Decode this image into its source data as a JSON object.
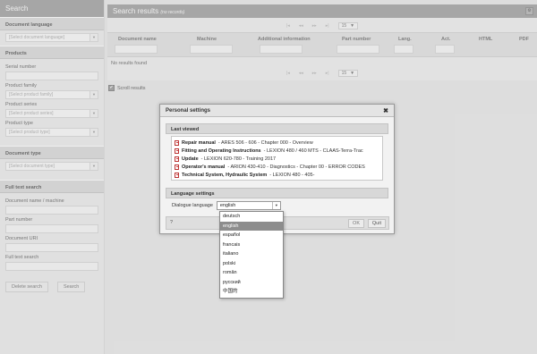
{
  "sidebar": {
    "title": "Search",
    "sections": {
      "document_language": {
        "title": "Document language",
        "select_placeholder": "[Select document language]"
      },
      "products": {
        "title": "Products",
        "serial_number_label": "Serial number",
        "product_family_label": "Product family",
        "product_family_placeholder": "[Select product family]",
        "product_series_label": "Product series",
        "product_series_placeholder": "[Select product series]",
        "product_type_label": "Product type",
        "product_type_placeholder": "[Select product type]"
      },
      "document_type": {
        "title": "Document type",
        "select_placeholder": "[Select document type]"
      },
      "full_text_search": {
        "title": "Full text search",
        "doc_name_label": "Document name / machine",
        "part_number_label": "Part number",
        "document_uri_label": "Document URI",
        "full_text_label": "Full text search"
      }
    },
    "buttons": {
      "delete_search": "Delete search",
      "search": "Search"
    }
  },
  "main": {
    "header_title": "Search results",
    "header_sub": "(no records)",
    "pager": {
      "first": "|◂",
      "prev": "◂◂",
      "next": "▸▸",
      "last": "▸|",
      "page_size": "15"
    },
    "columns": [
      "Document name",
      "Machine",
      "Additional information",
      "Part number",
      "Lang.",
      "Act.",
      "HTML",
      "PDF"
    ],
    "no_results": "No results found",
    "scroll_results": "Scroll results"
  },
  "dialog": {
    "title": "Personal settings",
    "close_glyph": "✖",
    "last_viewed_title": "Last viewed",
    "last_viewed": [
      {
        "bold": "Repair manual",
        "rest": " - ARES 506 - 606 - Chapter 000 - Overview"
      },
      {
        "bold": "Fitting and Operating Instructions",
        "rest": " - LEXION 480 / 460 MTS - CLAAS-Terra-Trac"
      },
      {
        "bold": "Update",
        "rest": " - LEXION 620-780 - Training 2017"
      },
      {
        "bold": "Operator's manual",
        "rest": " - ARION 430-410 - Diagnostics - Chapter 00 - ERROR CODES"
      },
      {
        "bold": "Technical System, Hydraulic System",
        "rest": " - LEXION 480 - 405-"
      }
    ],
    "language_settings_title": "Language settings",
    "dialogue_language_label": "Dialogue language",
    "selected_language": "english",
    "help_label": "?",
    "ok_label": "OK",
    "quit_label": "Quit"
  },
  "language_options": [
    "deutsch",
    "english",
    "español",
    "francais",
    "italiano",
    "polski",
    "român",
    "русский",
    "中国的"
  ],
  "colors": {
    "header_gray": "#8f8f8f",
    "selected_option": "#8d8d8d"
  }
}
